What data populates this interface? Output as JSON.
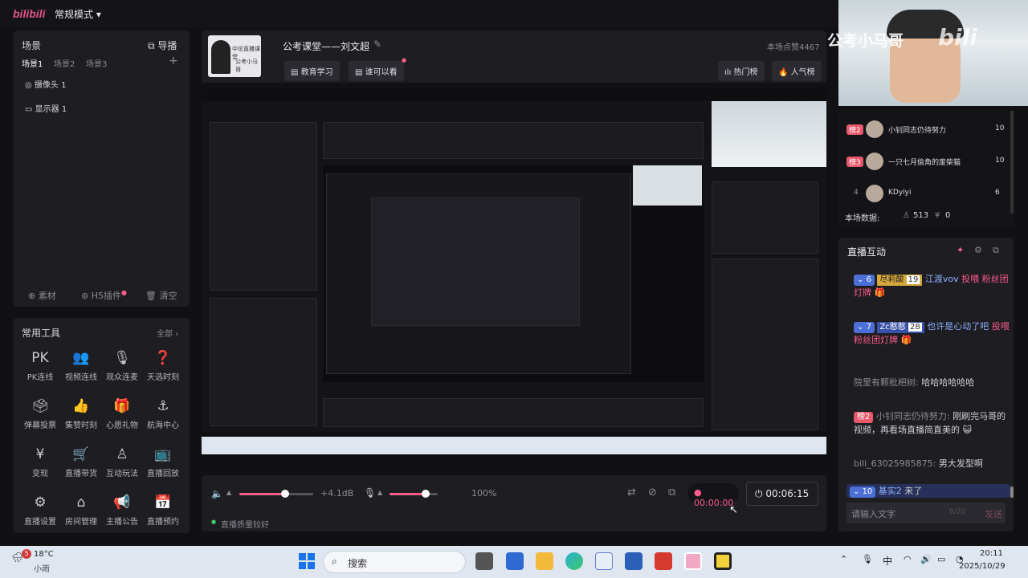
{
  "app": {
    "logo": "bilibili",
    "mode": "常规模式 ▾"
  },
  "scene": {
    "title": "场景",
    "import": "导播",
    "tabs": [
      "场景1",
      "场景2",
      "场景3"
    ],
    "add": "+",
    "sources": [
      "摄像头 1",
      "显示器 1"
    ],
    "footer": [
      "素材",
      "H5插件",
      "清空"
    ]
  },
  "tools": {
    "title": "常用工具",
    "all": "全部 ›",
    "items": [
      {
        "icon": "PK",
        "label": "PK连线"
      },
      {
        "icon": "👥",
        "label": "视频连线"
      },
      {
        "icon": "🎙",
        "label": "观众连麦"
      },
      {
        "icon": "❓",
        "label": "天选时刻"
      },
      {
        "icon": "🗳",
        "label": "弹幕投票"
      },
      {
        "icon": "👍",
        "label": "集赞时刻"
      },
      {
        "icon": "🎁",
        "label": "心愿礼物"
      },
      {
        "icon": "⚓",
        "label": "航海中心"
      },
      {
        "icon": "¥",
        "label": "变现"
      },
      {
        "icon": "🛒",
        "label": "直播带货"
      },
      {
        "icon": "♙",
        "label": "互动玩法"
      },
      {
        "icon": "📺",
        "label": "直播回放"
      },
      {
        "icon": "⚙",
        "label": "直播设置"
      },
      {
        "icon": "⌂",
        "label": "房间管理"
      },
      {
        "icon": "📢",
        "label": "主播公告"
      },
      {
        "icon": "📅",
        "label": "直播预约"
      }
    ]
  },
  "header": {
    "avatar_caption": "中论直播课堂",
    "avatar_sub": "公考小马哥",
    "title": "公考课堂——刘文超",
    "edit_icon": "edit-icon",
    "tag_category": "教育学习",
    "tag_visibility": "谁可以看",
    "views": "本场点赞4467",
    "hot_rank": "热门榜",
    "popular_rank": "人气榜"
  },
  "controls": {
    "speaker_db": "+4.1dB",
    "mic_pct": "100%",
    "speaker_level": 0.62,
    "mic_level": 0.75,
    "rec_time": "00:00:00",
    "live_time": "00:06:15",
    "quality": "直播质量较好"
  },
  "camera": {
    "watermark": "公考小马哥"
  },
  "rank": {
    "rows": [
      {
        "rank": "榜2",
        "name": "小钊同志仍待努力",
        "score": "10"
      },
      {
        "rank": "榜3",
        "name": "一只七月偷角的废柴猫",
        "score": "10"
      },
      {
        "rank": "4",
        "name": "KDyiyi",
        "score": "6"
      }
    ],
    "stats_label": "本场数据:",
    "viewers": "513",
    "coins": "0"
  },
  "live": {
    "title": "直播互动",
    "messages": [
      {
        "level": "6",
        "medal": "尽莉酸",
        "medal_lv": "19",
        "user": "江渡vov",
        "text": "投喂 粉丝团灯牌"
      },
      {
        "level": "7",
        "medal": "Zc憨憨",
        "medal_lv": "28",
        "user": "也许是心动了吧",
        "text": "投喂 粉丝团灯牌"
      },
      {
        "user": "院里有颗枇杷树:",
        "text": "哈哈哈哈哈哈"
      },
      {
        "badge": "榜2",
        "user": "小钊同志仍待努力:",
        "text": "刚刷完马哥的视频，再看场直播简直美的"
      },
      {
        "user": "bili_63025985875:",
        "text": "男大发型啊"
      },
      {
        "level": "10",
        "user": "基实2",
        "text": "来了"
      }
    ],
    "input_placeholder": "请输入文字",
    "counter": "0/20",
    "send": "发送"
  },
  "taskbar": {
    "weather_temp": "18°C",
    "weather_desc": "小雨",
    "badge": "5",
    "search": "搜索",
    "ime": "中",
    "time": "20:11",
    "date": "2025/10/29"
  }
}
